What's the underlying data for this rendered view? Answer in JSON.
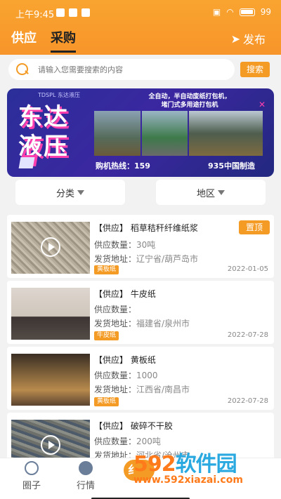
{
  "status_bar": {
    "time": "上午9:45",
    "battery": "99"
  },
  "header": {
    "tabs": [
      {
        "label": "供应"
      },
      {
        "label": "采购"
      }
    ],
    "publish_label": "发布"
  },
  "search": {
    "placeholder": "请输入您需要搜索的内容",
    "button": "搜索"
  },
  "banner": {
    "brand": "东达\n液压",
    "small_tag": "TDSPL 东达液压",
    "headline": "全自动，半自动废纸打包机，\n堵门式多用途打包机",
    "hotline": "购机热线：159",
    "made": "935中国制造"
  },
  "filters": {
    "category": "分类",
    "region": "地区"
  },
  "listings": [
    {
      "title": "【供应】 稻草秸秆纤维纸浆",
      "qty_label": "供应数量：",
      "qty": "30吨",
      "addr_label": "发货地址：",
      "addr": "辽宁省/葫芦岛市",
      "tag": "黄板纸",
      "date": "2022-01-05",
      "badge": "置顶"
    },
    {
      "title": "【供应】 牛皮纸",
      "qty_label": "供应数量：",
      "qty": "",
      "addr_label": "发货地址：",
      "addr": "福建省/泉州市",
      "tag": "牛皮纸",
      "date": "2022-07-28"
    },
    {
      "title": "【供应】 黄板纸",
      "qty_label": "供应数量：",
      "qty": "1000",
      "addr_label": "发货地址：",
      "addr": "江西省/南昌市",
      "tag": "黄板纸",
      "date": "2022-07-28"
    },
    {
      "title": "【供应】 破碎不干胶",
      "qty_label": "供应数量：",
      "qty": "200吨",
      "addr_label": "发货地址：",
      "addr": "河北省/沧州市"
    }
  ],
  "bottom_nav": [
    {
      "label": "圈子"
    },
    {
      "label": "行情"
    }
  ],
  "fab_label": "纟",
  "watermark": {
    "brand_a": "592",
    "brand_b": "软件园",
    "url": "www.592xiazai.com"
  },
  "colors": {
    "accent": "#f49b26",
    "header": "#f7952a"
  }
}
